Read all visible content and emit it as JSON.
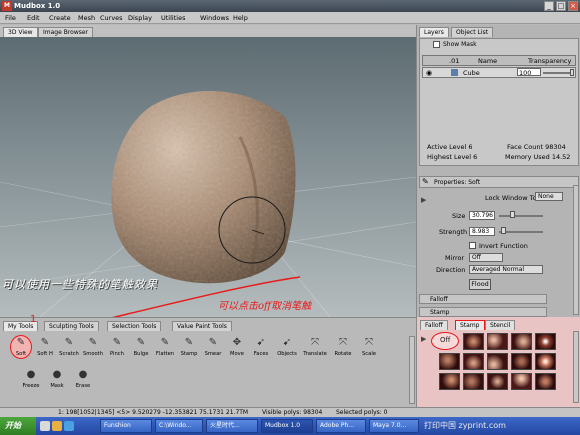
{
  "window": {
    "title": "Mudbox 1.0",
    "logo": "M",
    "min_label": "_",
    "max_label": "□",
    "close_label": "×"
  },
  "menu": [
    "File",
    "Edit",
    "Create",
    "Mesh",
    "Curves",
    "Display",
    "Utilities",
    "Windows",
    "Help"
  ],
  "viewport_tabs": [
    "3D View",
    "Image Browser"
  ],
  "annotations": {
    "left_note": "可以使用一些特殊的笔触效果",
    "red_note": "可以点击off取消笔触",
    "marker_1": "1",
    "marker_2": "2"
  },
  "layers": {
    "tabs": [
      "Layers",
      "Object List"
    ],
    "show_mask": "Show Mask",
    "columns": [
      "",
      ".01",
      "Name",
      "Transparency"
    ],
    "row": {
      "name": "Cube",
      "transparency": "100"
    },
    "active_level_label": "Active Level 6",
    "face_count_label": "Face Count 98304",
    "highest_level_label": "Highest Level 6",
    "memory_label": "Memory Used 14.52"
  },
  "properties": {
    "title": "Properties: Soft",
    "lock_window_label": "Lock Window To:",
    "lock_window_value": "None",
    "size_label": "Size",
    "size_value": "30.796",
    "size_level": 0.3,
    "strength_label": "Strength",
    "strength_value": "8.983",
    "strength_level": 0.09,
    "invert_label": "Invert Function",
    "mirror_label": "Mirror",
    "mirror_value": "Off",
    "direction_label": "Direction",
    "direction_value": "Averaged Normal",
    "flood_label": "Flood",
    "falloff_label": "Falloff",
    "stamp_label": "Stamp"
  },
  "tool_tabs": [
    "My Tools",
    "Sculpting Tools",
    "Selection Tools",
    "Value Paint Tools"
  ],
  "tools": [
    "Soft",
    "Soft H",
    "Scratch",
    "Smooth",
    "Pinch",
    "Bulge",
    "Flatten",
    "Stamp",
    "Smear",
    "Move",
    "Faces",
    "Objects",
    "Translate",
    "Rotate",
    "Scale",
    "Freeze",
    "Mask",
    "Erase"
  ],
  "stamp_tabs": [
    "Falloff",
    "Stamp",
    "Stencil"
  ],
  "stamp_off_label": "Off",
  "statusbar": {
    "cells": [
      "1: 198[1052|1345] <5> 9.520279 -12.353821 75.1731 21.7TM",
      "Visible polys: 98304",
      "Selected polys: 0"
    ]
  },
  "taskbar": {
    "start": "开始",
    "items": [
      "Funshion",
      "C:\\Windo...",
      "火星时代...",
      "Mudbox 1.0",
      "Adobe Ph...",
      "Maya 7.0..."
    ],
    "watermark": "打印中国 zyprint.com"
  },
  "colors": {
    "accent_red": "#e81a1a",
    "stamp_bg": "#e9c4c4",
    "mesh_brown": "#a98b72"
  }
}
